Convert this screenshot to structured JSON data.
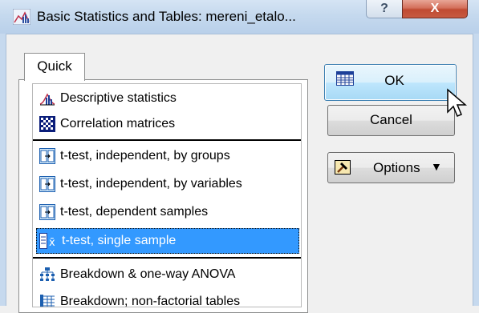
{
  "window": {
    "title": "Basic Statistics and Tables: mereni_etalo...",
    "help_label": "?",
    "close_label": "X"
  },
  "tabs": [
    {
      "label": "Quick"
    }
  ],
  "list": {
    "items": [
      {
        "label": "Descriptive statistics",
        "icon": "descriptive-stats-icon"
      },
      {
        "label": "Correlation matrices",
        "icon": "correlation-matrix-icon"
      },
      {
        "label": "t-test, independent, by groups",
        "icon": "t-test-icon"
      },
      {
        "label": "t-test, independent, by variables",
        "icon": "t-test-icon"
      },
      {
        "label": "t-test, dependent samples",
        "icon": "t-test-icon"
      },
      {
        "label": "t-test, single sample",
        "icon": "single-sample-icon",
        "selected": true
      },
      {
        "label": "Breakdown & one-way ANOVA",
        "icon": "breakdown-anova-icon"
      },
      {
        "label": "Breakdown; non-factorial tables",
        "icon": "breakdown-table-icon"
      }
    ]
  },
  "buttons": {
    "ok": "OK",
    "cancel": "Cancel",
    "options": "Options"
  },
  "colors": {
    "selection": "#3399ff",
    "titlebar": "#c5d9ee",
    "close": "#c75a41"
  }
}
